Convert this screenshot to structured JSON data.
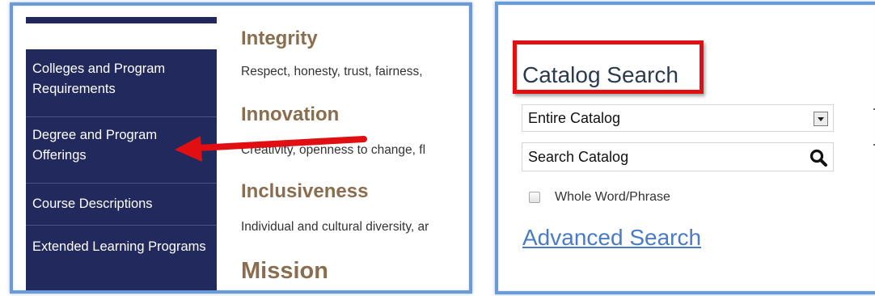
{
  "sidebar": {
    "items": [
      {
        "label": "Colleges and Program Requirements"
      },
      {
        "label": "Degree and Program Offerings"
      },
      {
        "label": "Course Descriptions"
      },
      {
        "label": "Extended Learning Programs"
      }
    ]
  },
  "content": {
    "values": [
      {
        "heading": "Integrity",
        "text": "Respect, honesty, trust, fairness,"
      },
      {
        "heading": "Innovation",
        "text": "Creativity, openness to change, fl"
      },
      {
        "heading": "Inclusiveness",
        "text": "Individual and cultural diversity, ar"
      }
    ],
    "mission_heading": "Mission"
  },
  "catalog_search": {
    "title": "Catalog Search",
    "scope_select": {
      "selected": "Entire Catalog"
    },
    "search_input": {
      "placeholder": "Search Catalog"
    },
    "whole_word_label": "Whole Word/Phrase",
    "advanced_search_label": "Advanced Search"
  },
  "colors": {
    "sidebar_bg": "#22295c",
    "heading_brown": "#8a6d4e",
    "frame_blue": "#6b9bd6",
    "annotation_red": "#e10e12",
    "link_blue": "#4a7bc4"
  },
  "icons": [
    "chevron-down-icon",
    "search-icon",
    "annotation-arrow-icon"
  ]
}
